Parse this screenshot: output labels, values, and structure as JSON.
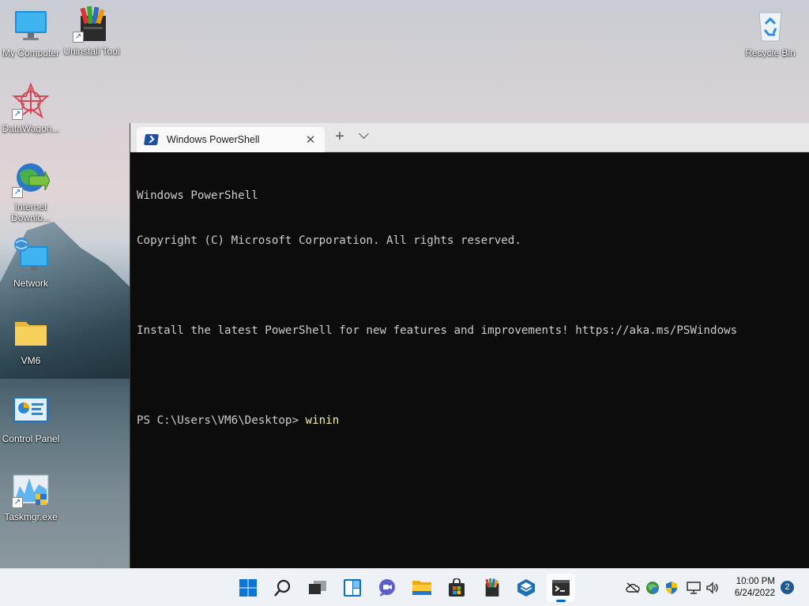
{
  "desktop": {
    "icons": [
      {
        "label": "My Computer",
        "icon": "monitor-icon"
      },
      {
        "label": "Uninstall Tool",
        "icon": "uninstall-tool-icon"
      },
      {
        "label": "DataWagon...",
        "icon": "datawagon-icon"
      },
      {
        "label": "Internet",
        "label2": "Downlo...",
        "icon": "internet-download-manager-icon"
      },
      {
        "label": "Network",
        "icon": "network-icon"
      },
      {
        "label": "VM6",
        "icon": "folder-icon"
      },
      {
        "label": "Control Panel",
        "icon": "control-panel-icon"
      },
      {
        "label": "Taskmgr.exe",
        "icon": "task-manager-icon"
      },
      {
        "label": "Recycle Bin",
        "icon": "recycle-bin-icon"
      }
    ]
  },
  "terminal": {
    "tab_title": "Windows PowerShell",
    "tab_close": "✕",
    "new_tab": "+",
    "lines": [
      "Windows PowerShell",
      "Copyright (C) Microsoft Corporation. All rights reserved.",
      "",
      "Install the latest PowerShell for new features and improvements! https://aka.ms/PSWindows",
      ""
    ],
    "prompt": "PS C:\\Users\\VM6\\Desktop> ",
    "command": "winin"
  },
  "taskbar": {
    "apps": [
      "start-icon",
      "search-icon",
      "task-view-icon",
      "widgets-icon",
      "chat-icon",
      "file-explorer-icon",
      "store-icon",
      "uninstall-tool-icon",
      "virtualbox-icon",
      "terminal-icon"
    ],
    "tray": [
      "onedrive-offline-icon",
      "network-globe-icon",
      "security-shield-icon",
      "display-icon",
      "volume-icon"
    ],
    "time": "10:00 PM",
    "date": "6/24/2022",
    "notification_count": "2"
  },
  "colors": {
    "console_bg": "#0c0c0c",
    "console_text": "#cccccc",
    "command_text": "#f9f1a5",
    "accent": "#0067c0"
  }
}
